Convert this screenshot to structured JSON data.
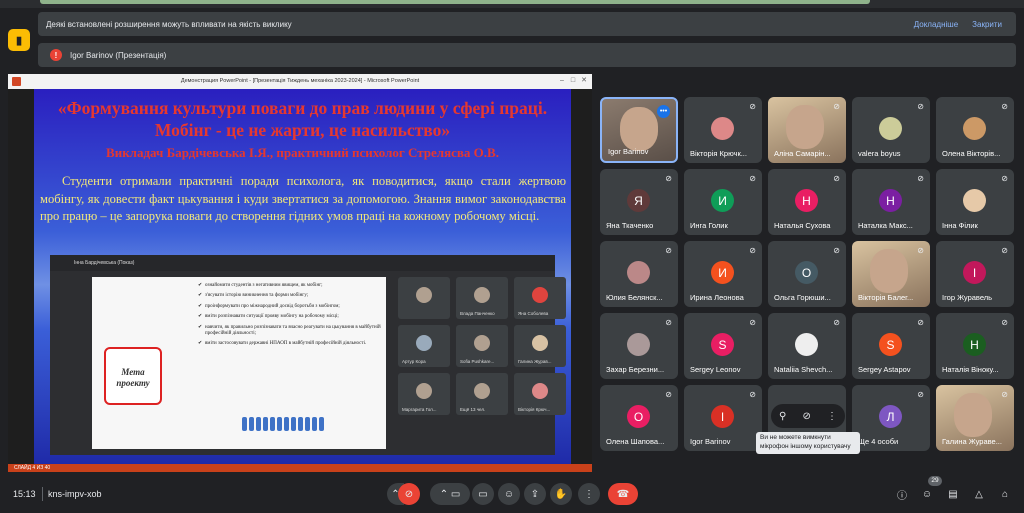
{
  "banner1": {
    "text": "Деякі встановлені розширення можуть впливати на якість виклику",
    "details": "Докладніше",
    "close": "Закрити"
  },
  "banner2": {
    "text": "Igor Barinov (Презентація)"
  },
  "ppt": {
    "window_title": "Демонстрация PowerPoint - [Презентація Тиждень механіка 2023-2024] - Microsoft PowerPoint",
    "status": "СЛАЙД 4 ИЗ 40"
  },
  "slide": {
    "title": "«Формування культури поваги до прав людини у сфері праці. Мобінг - це не жарти, це насильство»",
    "subtitle": "Викладач Бардічевська І.Я., практичний психолог Стрелясва О.В.",
    "body": "Студенти отримали практичні поради психолога, як поводитися, якщо стали жертвою мобінгу, як довести факт цькування і куди звертатися за допомогою. Знання вимог законодавства про працю – це запорука поваги до створення гідних умов праці на кожному робочому місці."
  },
  "inner": {
    "header": "Інна Бардічевська (Показ)",
    "meta": "Мета проекту",
    "list": [
      "ознайомити студентів з негативним явищем, як мобінг;",
      "з'ясувати історію виникнення та форми мобінгу;",
      "проінформувати про міжнародний досвід боротьби з мобінгом;",
      "вміти розпізнавати ситуації прояву мобінгу на робочому місці;",
      "навчити, як правильно розпізнавати та вчасно реагувати на цькування в майбутній професійній діяльності;",
      "вміти застосовувати державні НПАОП в майбутній професійній діяльності."
    ],
    "tiles": [
      "",
      "Влада Панченко",
      "Яна Соболева",
      "Артур Кора",
      "Sofia Pushkare...",
      "Галина Журав...",
      "Маргарита Гол...",
      "Ещё 13 чел.",
      "Вікторія Крюч..."
    ]
  },
  "participants": [
    {
      "name": "Igor Barinov",
      "type": "video",
      "active": true
    },
    {
      "name": "Вікторія Крючк...",
      "type": "avatar-img",
      "color": "#d88",
      "letter": ""
    },
    {
      "name": "Аліна Самарін...",
      "type": "video2"
    },
    {
      "name": "valera boyus",
      "type": "avatar-img",
      "color": "#cc9",
      "letter": ""
    },
    {
      "name": "Олена Вікторів...",
      "type": "avatar-img",
      "color": "#c96",
      "letter": ""
    },
    {
      "name": "Яна Ткаченко",
      "letter": "Я",
      "color": "#5f3a3a"
    },
    {
      "name": "Инга Голик",
      "letter": "И",
      "color": "#0f9d58"
    },
    {
      "name": "Наталья Сухова",
      "letter": "Н",
      "color": "#e91e63"
    },
    {
      "name": "Наталка Макс...",
      "letter": "Н",
      "color": "#7b1fa2"
    },
    {
      "name": "Інна Філик",
      "type": "avatar-img",
      "color": "#e6c9a8",
      "letter": ""
    },
    {
      "name": "Юлия Белянск...",
      "type": "avatar-img",
      "color": "#b88",
      "letter": ""
    },
    {
      "name": "Ирина Леонова",
      "letter": "И",
      "color": "#f4511e"
    },
    {
      "name": "Ольга Горюши...",
      "letter": "О",
      "color": "#455a64"
    },
    {
      "name": "Вікторія Балег...",
      "type": "video2"
    },
    {
      "name": "Ігор Журавель",
      "letter": "І",
      "color": "#c2185b"
    },
    {
      "name": "Захар Березни...",
      "type": "avatar-img",
      "color": "#a99",
      "letter": ""
    },
    {
      "name": "Sergey Leonov",
      "letter": "S",
      "color": "#e91e63"
    },
    {
      "name": "Nataliia Shevch...",
      "type": "avatar-img",
      "color": "#eee",
      "letter": ""
    },
    {
      "name": "Sergey Astapov",
      "letter": "S",
      "color": "#f4511e"
    },
    {
      "name": "Наталія Віноку...",
      "letter": "Н",
      "color": "#1b5e20"
    },
    {
      "name": "Олена Шапова...",
      "letter": "О",
      "color": "#e91e63"
    },
    {
      "name": "Igor Barinov",
      "letter": "I",
      "color": "#d93025"
    },
    {
      "name": "",
      "letter": "",
      "color": "#3c4043"
    },
    {
      "name": "Ще 4 особи",
      "letter": "Л",
      "color": "#7e57c2"
    },
    {
      "name": "Галина Жураве...",
      "type": "video2"
    }
  ],
  "tooltip": "Ви не можете вимкнути мікрофон іншому користувачу",
  "bottom": {
    "time": "15:13",
    "meeting_code": "kns-impv-xob",
    "people_count": "29"
  },
  "icons": {
    "mic_off": "mic-off-icon",
    "chevron": "chevron-up-icon",
    "cam": "camera-icon",
    "cc": "captions-icon",
    "emoji": "emoji-icon",
    "present": "present-icon",
    "hand": "raise-hand-icon",
    "more": "more-vert-icon",
    "end": "end-call-icon",
    "info": "info-icon",
    "people": "people-icon",
    "chat": "chat-icon",
    "activities": "activities-icon",
    "lock": "host-controls-icon"
  }
}
